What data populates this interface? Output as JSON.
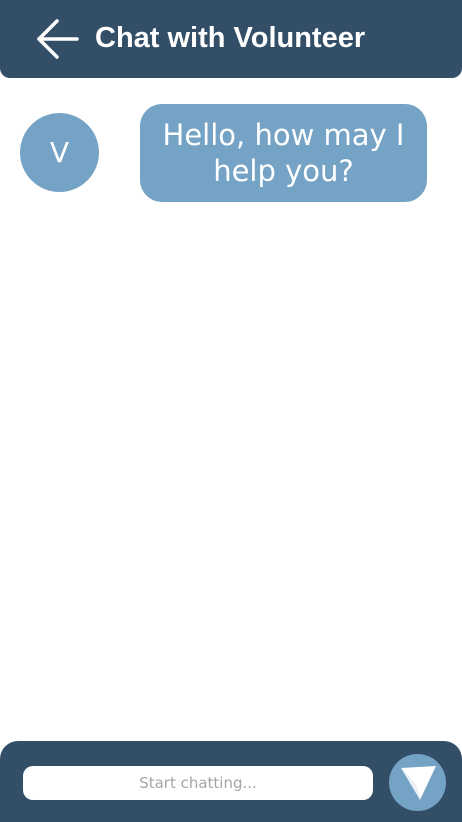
{
  "header": {
    "title": "Chat with Volunteer",
    "back_icon": "arrow-left-icon"
  },
  "messages": [
    {
      "sender_initial": "V",
      "text": "Hello, how may I help you?"
    }
  ],
  "composer": {
    "placeholder": "Start chatting...",
    "value": "",
    "send_icon": "send-icon"
  },
  "colors": {
    "header_bg": "#334f68",
    "accent": "#75a3c5",
    "background": "#ffffff"
  }
}
